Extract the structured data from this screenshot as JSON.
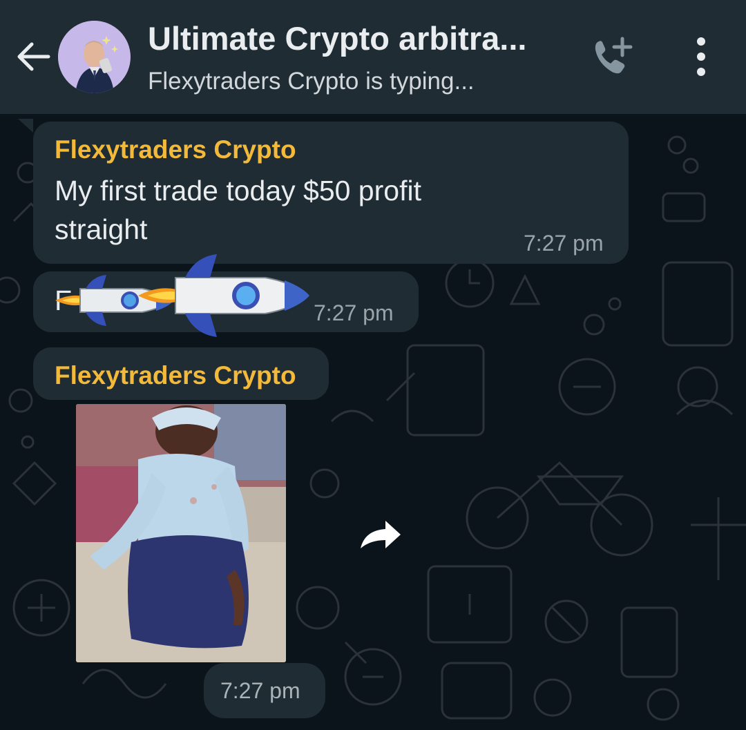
{
  "header": {
    "title": "Ultimate Crypto arbitra...",
    "status": "Flexytraders Crypto is typing...",
    "back_icon": "arrow-left-icon",
    "call_icon": "add-call-icon",
    "menu_icon": "vertical-dots-icon"
  },
  "messages": [
    {
      "sender": "Flexytraders Crypto",
      "text_line1": "My first trade today $50 profit",
      "text_line2": "straight",
      "time": "7:27 pm"
    },
    {
      "text_partial": "F",
      "emojis": [
        "rocket",
        "rocket"
      ],
      "time": "7:27 pm"
    },
    {
      "sender": "Flexytraders Crypto",
      "media": "video-thumbnail",
      "time": "7:27 pm"
    }
  ],
  "colors": {
    "background": "#0b141a",
    "header": "#1f2c33",
    "bubble": "#1f2c33",
    "sender_name": "#f3b93a",
    "text": "#e9edef",
    "timestamp": "#9aa4aa"
  }
}
